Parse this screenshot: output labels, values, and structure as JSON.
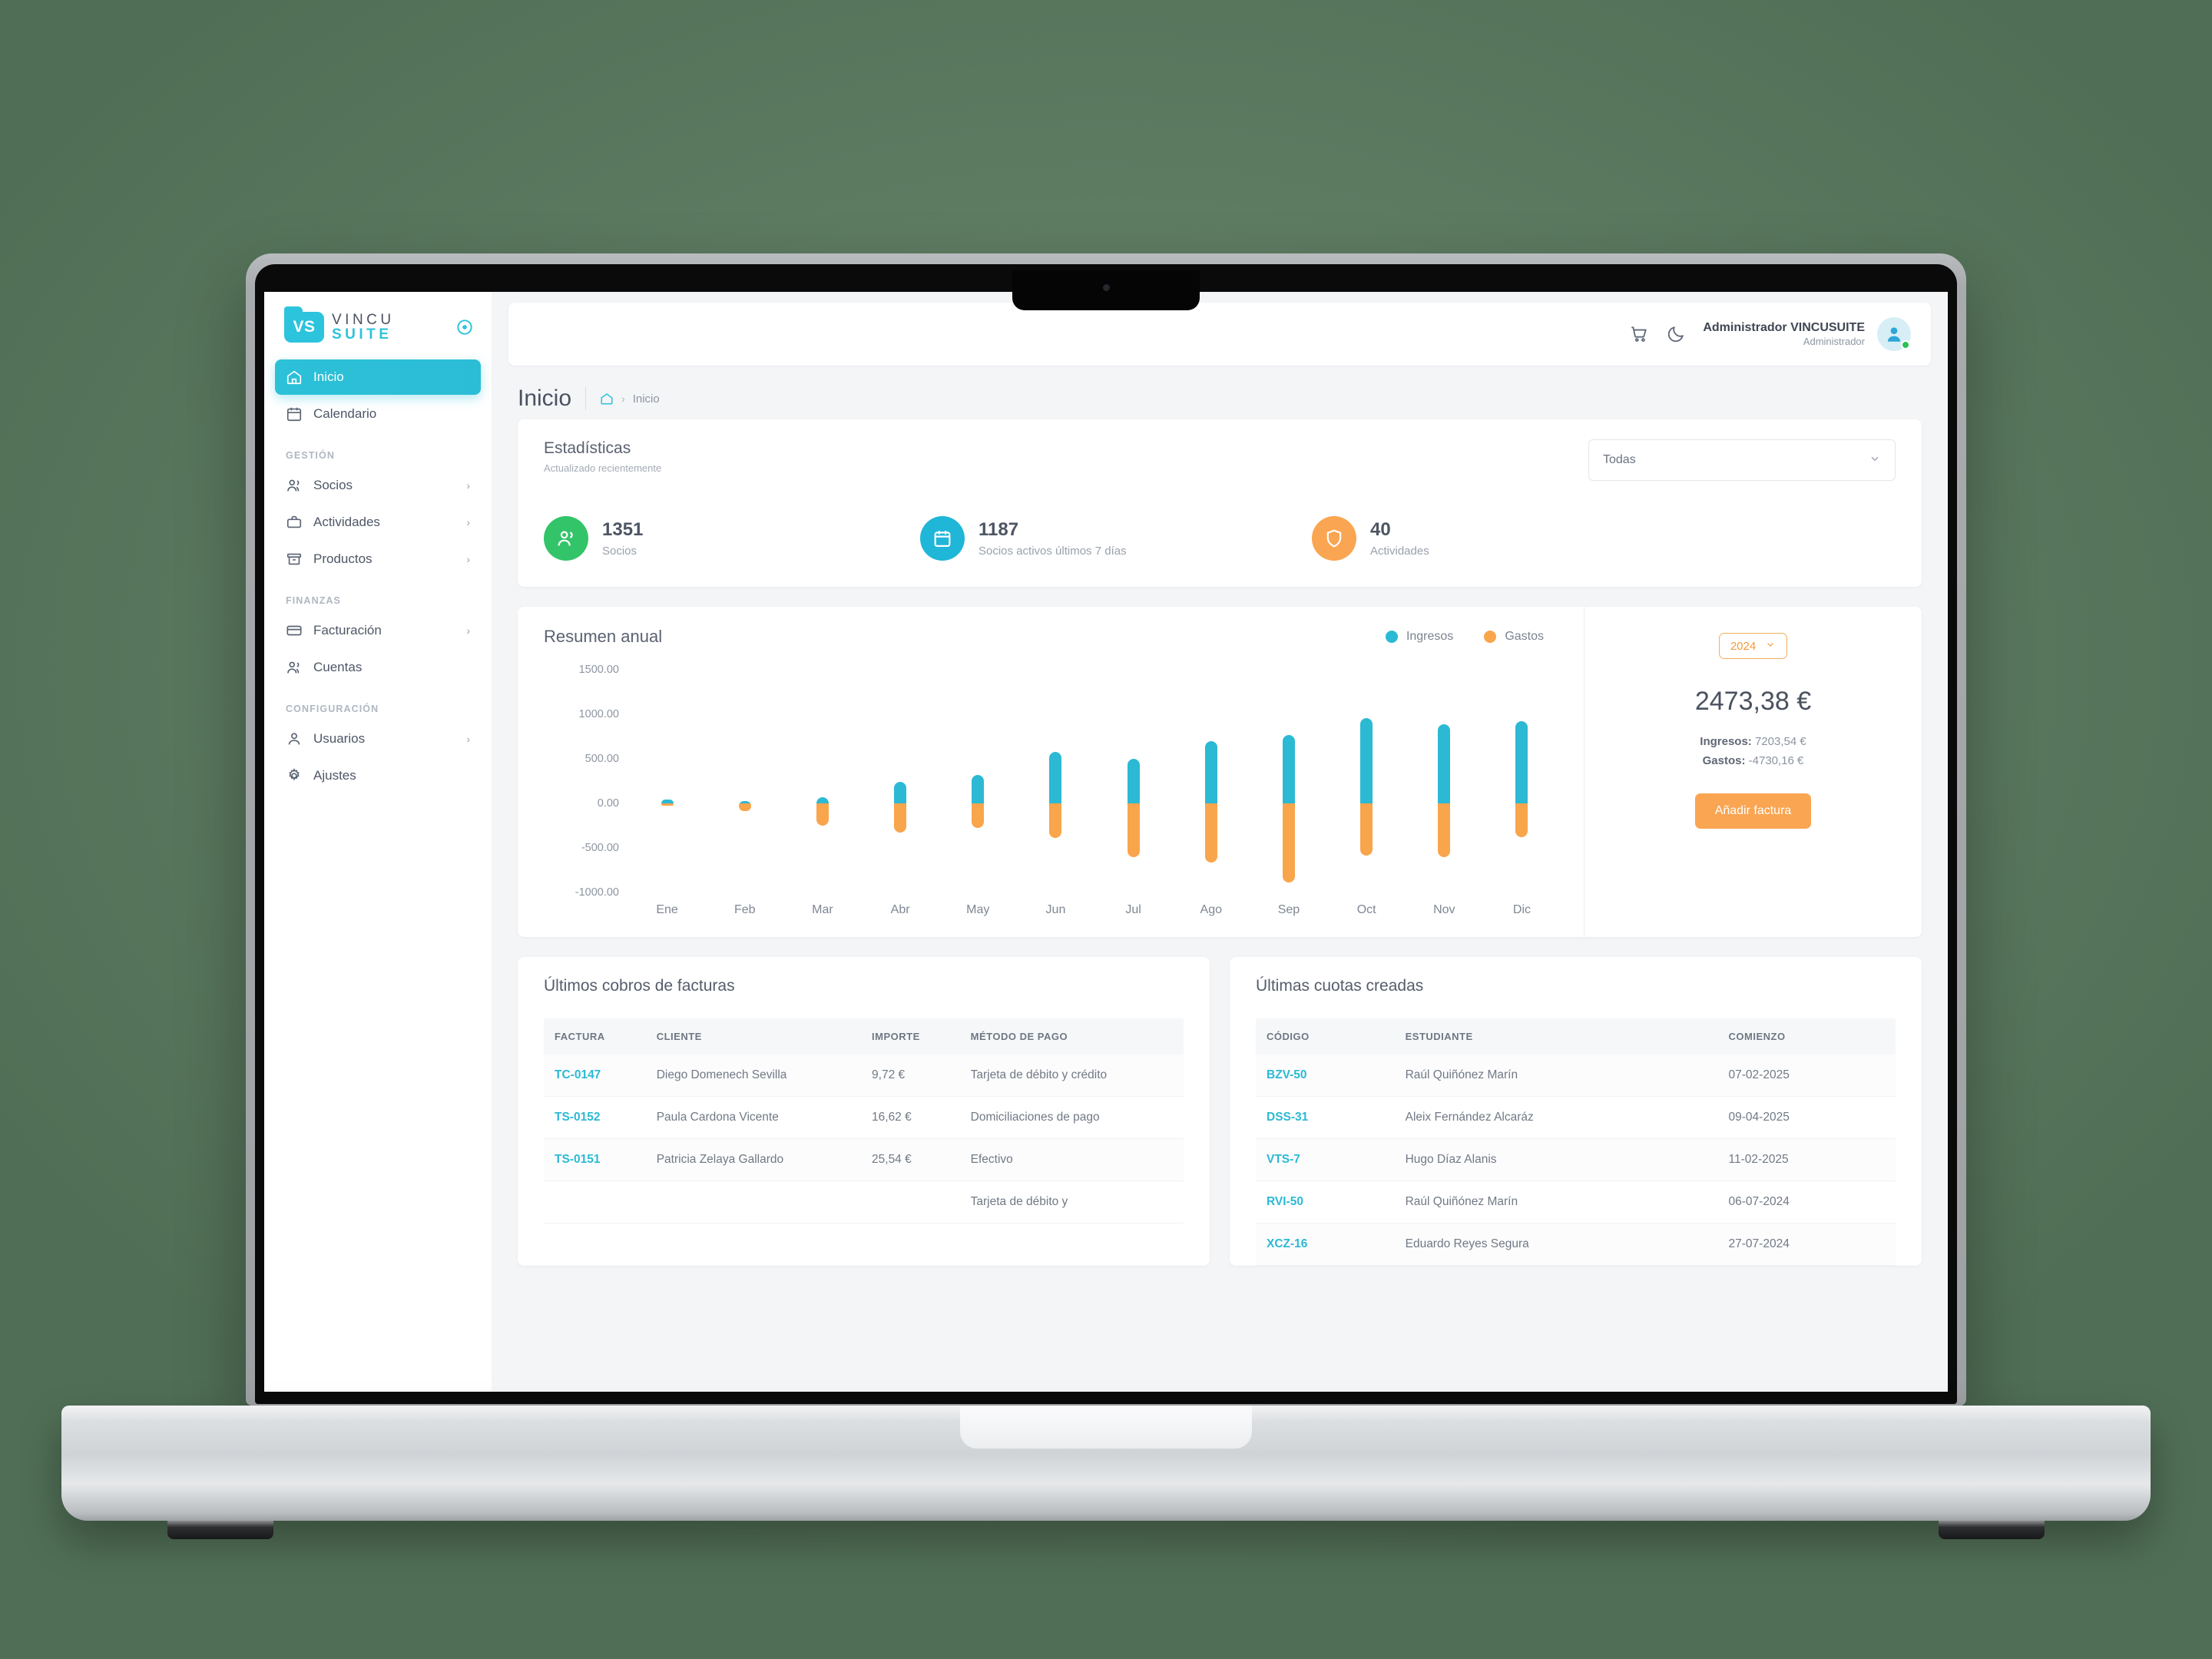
{
  "sidebar": {
    "logo": {
      "badge": "VS",
      "line1": "VINCU",
      "line2": "SUITE"
    },
    "items": [
      {
        "label": "Inicio",
        "icon": "home-icon",
        "active": true,
        "chevron": ""
      },
      {
        "label": "Calendario",
        "icon": "calendar-icon",
        "active": false,
        "chevron": ""
      }
    ],
    "sections": [
      {
        "title": "GESTIÓN",
        "items": [
          {
            "label": "Socios",
            "icon": "users-icon",
            "chevron": "›"
          },
          {
            "label": "Actividades",
            "icon": "briefcase-icon",
            "chevron": "›"
          },
          {
            "label": "Productos",
            "icon": "box-icon",
            "chevron": "›"
          }
        ]
      },
      {
        "title": "FINANZAS",
        "items": [
          {
            "label": "Facturación",
            "icon": "card-icon",
            "chevron": "›"
          },
          {
            "label": "Cuentas",
            "icon": "users-icon",
            "chevron": ""
          }
        ]
      },
      {
        "title": "CONFIGURACIÓN",
        "items": [
          {
            "label": "Usuarios",
            "icon": "user-icon",
            "chevron": "›"
          },
          {
            "label": "Ajustes",
            "icon": "gear-icon",
            "chevron": ""
          }
        ]
      }
    ]
  },
  "topbar": {
    "cart_icon": "cart-icon",
    "theme_icon": "moon-icon",
    "user_name": "Administrador VINCUSUITE",
    "user_role": "Administrador",
    "avatar_icon": "avatar-person-icon"
  },
  "breadcrumb": {
    "page_title": "Inicio",
    "home_icon": "home-icon",
    "separator": "›",
    "current": "Inicio"
  },
  "stats": {
    "title": "Estadísticas",
    "subtitle": "Actualizado recientemente",
    "filter": {
      "value": "Todas",
      "chevron_icon": "chevron-down-icon"
    },
    "items": [
      {
        "value": "1351",
        "label": "Socios",
        "color": "#33c46a",
        "icon": "users-icon"
      },
      {
        "value": "1187",
        "label": "Socios activos últimos 7 días",
        "color": "#1fb6d8",
        "icon": "calendar-icon"
      },
      {
        "value": "40",
        "label": "Actividades",
        "color": "#f9a552",
        "icon": "shield-icon"
      }
    ]
  },
  "chart_data": {
    "type": "bar",
    "title": "Resumen anual",
    "xlabel": "",
    "ylabel": "",
    "ylim": [
      -1000,
      1500
    ],
    "yticks": [
      1500,
      1000,
      500,
      0,
      -500,
      -1000
    ],
    "ytick_labels": [
      "1500.00",
      "1000.00",
      "500.00",
      "0.00",
      "-500.00",
      "-1000.00"
    ],
    "grid": false,
    "legend_position": "top-right",
    "categories": [
      "Ene",
      "Feb",
      "Mar",
      "Abr",
      "May",
      "Jun",
      "Jul",
      "Ago",
      "Sep",
      "Oct",
      "Nov",
      "Dic"
    ],
    "series": [
      {
        "name": "Ingresos",
        "color": "#2cb9d4",
        "values": [
          40,
          30,
          70,
          240,
          320,
          580,
          500,
          700,
          770,
          960,
          890,
          920
        ]
      },
      {
        "name": "Gastos",
        "color": "#f9a54c",
        "values": [
          -25,
          -90,
          -250,
          -330,
          -280,
          -390,
          -600,
          -660,
          -890,
          -590,
          -600,
          -380
        ]
      }
    ]
  },
  "summary": {
    "year": "2024",
    "year_chevron_icon": "chevron-down-icon",
    "total": "2473,38 €",
    "income_label": "Ingresos:",
    "income_value": "7203,54 €",
    "expense_label": "Gastos:",
    "expense_value": "-4730,16 €",
    "add_invoice_button": "Añadir factura"
  },
  "invoices_table": {
    "title": "Últimos cobros de facturas",
    "headers": [
      "FACTURA",
      "CLIENTE",
      "IMPORTE",
      "MÉTODO DE PAGO"
    ],
    "rows": [
      {
        "factura": "TC-0147",
        "cliente": "Diego Domenech Sevilla",
        "importe": "9,72 €",
        "metodo": "Tarjeta de débito y crédito"
      },
      {
        "factura": "TS-0152",
        "cliente": "Paula Cardona Vicente",
        "importe": "16,62 €",
        "metodo": "Domiciliaciones de pago"
      },
      {
        "factura": "TS-0151",
        "cliente": "Patricia Zelaya Gallardo",
        "importe": "25,54 €",
        "metodo": "Efectivo"
      },
      {
        "factura": "",
        "cliente": "",
        "importe": "",
        "metodo": "Tarjeta de débito y"
      }
    ]
  },
  "quotas_table": {
    "title": "Últimas cuotas creadas",
    "headers": [
      "CÓDIGO",
      "ESTUDIANTE",
      "COMIENZO"
    ],
    "rows": [
      {
        "codigo": "BZV-50",
        "estudiante": "Raúl Quiñónez Marín",
        "comienzo": "07-02-2025"
      },
      {
        "codigo": "DSS-31",
        "estudiante": "Aleix Fernández Alcaráz",
        "comienzo": "09-04-2025"
      },
      {
        "codigo": "VTS-7",
        "estudiante": "Hugo Díaz Alanis",
        "comienzo": "11-02-2025"
      },
      {
        "codigo": "RVI-50",
        "estudiante": "Raúl Quiñónez Marín",
        "comienzo": "06-07-2024"
      },
      {
        "codigo": "XCZ-16",
        "estudiante": "Eduardo Reyes Segura",
        "comienzo": "27-07-2024"
      }
    ]
  },
  "colors": {
    "accent_cyan": "#2cc3dd",
    "accent_orange": "#f9a552",
    "accent_green": "#33c46a",
    "bg": "#f4f5f7"
  }
}
